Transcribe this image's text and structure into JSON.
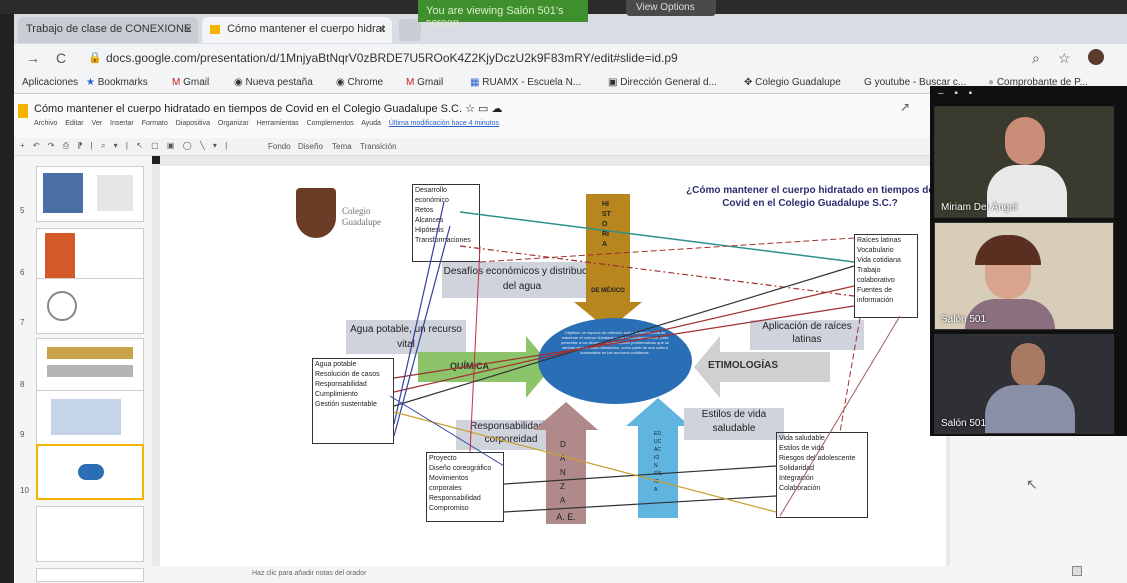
{
  "browser": {
    "tabs": [
      {
        "label": "Trabajo de clase de CONEXIONE"
      },
      {
        "label": "Cómo mantener el cuerpo hidrat"
      }
    ],
    "close_glyph": "×",
    "screen_share_banner": "You are viewing Salón 501's screen",
    "view_options": "View Options",
    "url": "docs.google.com/presentation/d/1MnjyaBtNqrV0zBRDE7U5ROoK4Z2KjyDczU2k9F83mRY/edit#slide=id.p9",
    "bookmarks": [
      "Aplicaciones",
      "Bookmarks",
      "Gmail",
      "Nueva pestaña",
      "Chrome",
      "Gmail",
      "RUAMX - Escuela N...",
      "Dirección General d...",
      "Colegio Guadalupe",
      "youtube - Buscar c...",
      "Comprobante de P..."
    ]
  },
  "slides_app": {
    "title": "Cómo mantener el cuerpo hidratado en tiempos de Covid en el Colegio Guadalupe S.C.",
    "menu": [
      "Archivo",
      "Editar",
      "Ver",
      "Insertar",
      "Formato",
      "Diapositiva",
      "Organizar",
      "Herramientas",
      "Complementos",
      "Ayuda"
    ],
    "last_edit": "Última modificación hace 4 minutos",
    "toolbar": [
      "Fondo",
      "Diseño",
      "Tema",
      "Transición"
    ],
    "thumb_numbers": [
      "5",
      "6",
      "7",
      "8",
      "9",
      "10"
    ],
    "notes_placeholder": "Haz clic para añadir notas del orador"
  },
  "slide": {
    "logo_text": "Colegio Guadalupe",
    "heading": "¿Cómo mantener el cuerpo hidratado en tiempos de Covid en el Colegio Guadalupe S.C.?",
    "historia_box": [
      "Desarrollo",
      "económico",
      "Retos",
      "Alcances",
      "Hipótesis",
      "Transformaciones"
    ],
    "desafios_label": "Desafíos económicos y distribución del agua",
    "historia_arrow": "HISTORIA",
    "historia_arrow_sub": "DE MÉXICO",
    "agua_label": "Agua potable, un recurso vital",
    "quimica_label": "QUÍMICA",
    "quimica_box": [
      "Agua potable",
      "Resolución de casos",
      "Responsabilidad",
      "Cumplimiento",
      "Gestión sustentable"
    ],
    "etimologias_label": "ETIMOLOGÍAS",
    "raices_label": "Aplicación de raíces latinas",
    "etim_box": [
      "Raíces latinas",
      "Vocabulario",
      "Vida cotidiana",
      "Trabajo colaborativo",
      "Fuentes de información"
    ],
    "center_text": "Objetivo: un espacio de reflexión sobre la importancia de mantener el cuerpo hidratado en la comunidad escolar, para presentar a los alumnos las principales problemáticas que se derivan de una mala hidratación, como parte de una cultura sustentable en las acciones cotidianas.",
    "responsabilidad_label": "Responsabilidad y corporeidad",
    "danza_arrow": "DANZA",
    "ae_label": "A. E.",
    "danza_box": [
      "Proyecto",
      "Diseño coreográfico",
      "Movimientos corporales",
      "Responsabilidad",
      "Compromiso"
    ],
    "edfisica_arrow": "EDUCACIÓN FÍSICA",
    "estilos_label": "Estilos de vida saludable",
    "edfisica_box": [
      "Vida saludable",
      "Estilos de vida",
      "Riesgos del adolescente",
      "Solidaridad",
      "Integración",
      "Colaboración"
    ]
  },
  "video": {
    "participants": [
      "Miriam Del Ángel",
      "Salón 501",
      "Salón 501"
    ]
  },
  "colors": {
    "zoom_green": "#3f8f2e",
    "historia_arrow": "#b8861f",
    "quimica_arrow": "#8cc46a",
    "etim_arrow": "#d0d0d0",
    "center_ellipse": "#2a6fb5",
    "danza_arrow": "#b08a8a",
    "edfisica_arrow": "#5fb4e0"
  }
}
